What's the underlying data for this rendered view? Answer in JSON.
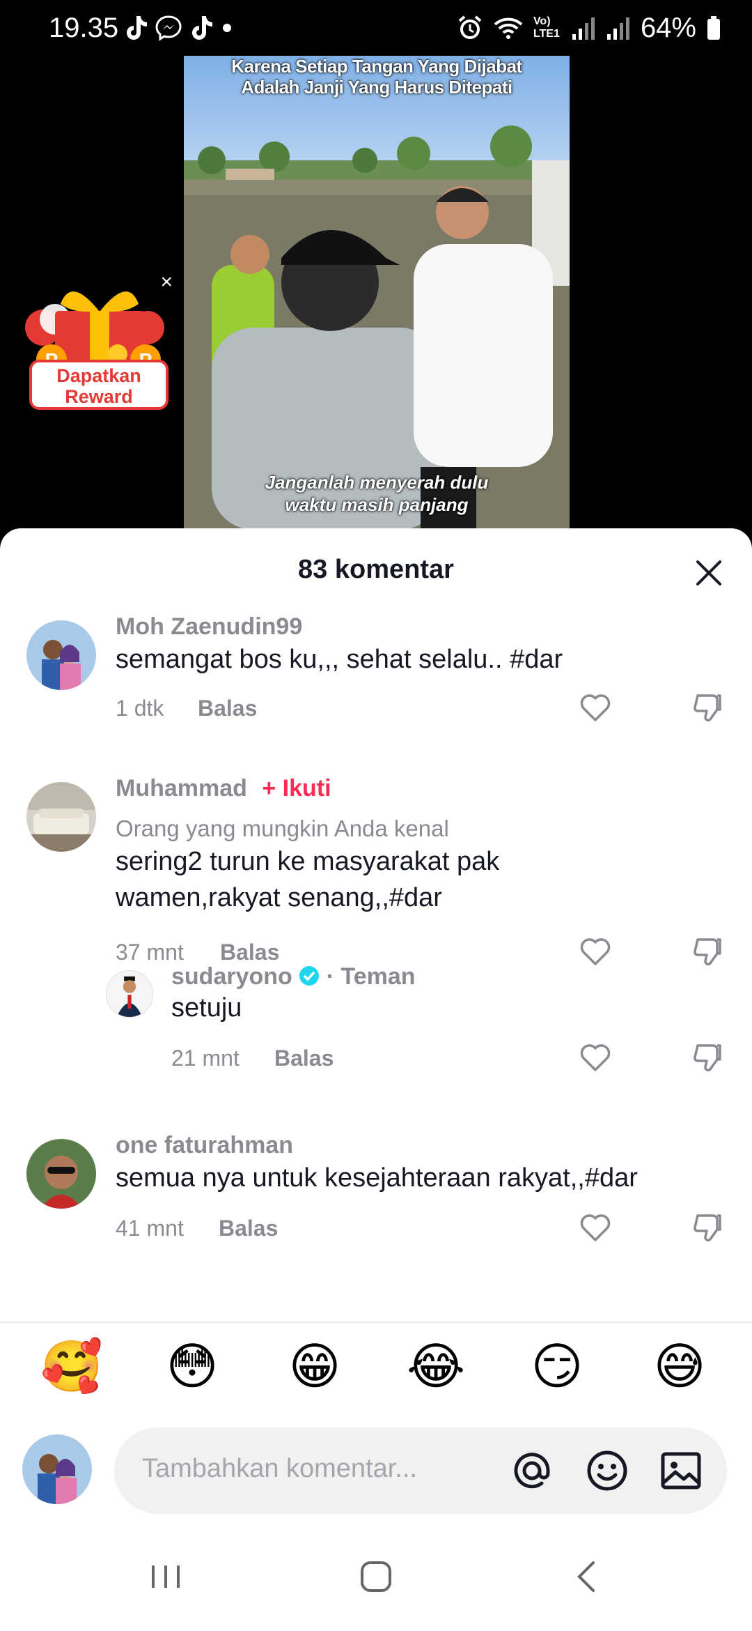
{
  "status": {
    "time": "19.35",
    "battery": "64%",
    "network": "Vo) LTE1"
  },
  "video": {
    "caption_top_line1": "Karena Setiap Tangan Yang Dijabat",
    "caption_top_line2": "Adalah Janji Yang Harus Ditepati",
    "caption_bottom_line1": "Janganlah menyerah dulu",
    "caption_bottom_line2": "waktu masih panjang"
  },
  "reward": {
    "line1": "Dapatkan",
    "line2": "Reward",
    "close": "×"
  },
  "sheet": {
    "title": "83 komentar"
  },
  "comments": [
    {
      "user": "Moh Zaenudin99",
      "text": "semangat bos ku,,, sehat selalu.. #dar",
      "time": "1 dtk",
      "reply": "Balas"
    },
    {
      "user": "Muhammad",
      "follow": "+ Ikuti",
      "subtitle": "Orang yang mungkin Anda kenal",
      "text_line1": "sering2 turun ke masyarakat pak",
      "text_line2": "wamen,rakyat senang,,#dar",
      "time": "37 mnt",
      "reply": "Balas"
    },
    {
      "user": "sudaryono",
      "relation": "· Teman",
      "text": "setuju",
      "time": "21 mnt",
      "reply": "Balas"
    },
    {
      "user": "one faturahman",
      "text": "semua nya untuk kesejahteraan rakyat,,#dar",
      "time": "41 mnt",
      "reply": "Balas"
    }
  ],
  "emojis": [
    "🥰",
    "😳",
    "😁",
    "😂",
    "😏",
    "😅"
  ],
  "input": {
    "placeholder": "Tambahkan komentar..."
  },
  "colors": {
    "accent": "#fe2c55",
    "verified": "#20d5ec",
    "muted": "#8a8b91",
    "text": "#161823"
  },
  "icons": [
    "tiktok-icon",
    "messenger-icon",
    "alarm-icon",
    "wifi-icon",
    "signal-icon",
    "battery-icon",
    "heart-icon",
    "dislike-icon",
    "close-icon",
    "at-icon",
    "emoji-icon",
    "image-icon",
    "recents-icon",
    "home-icon",
    "back-icon"
  ]
}
